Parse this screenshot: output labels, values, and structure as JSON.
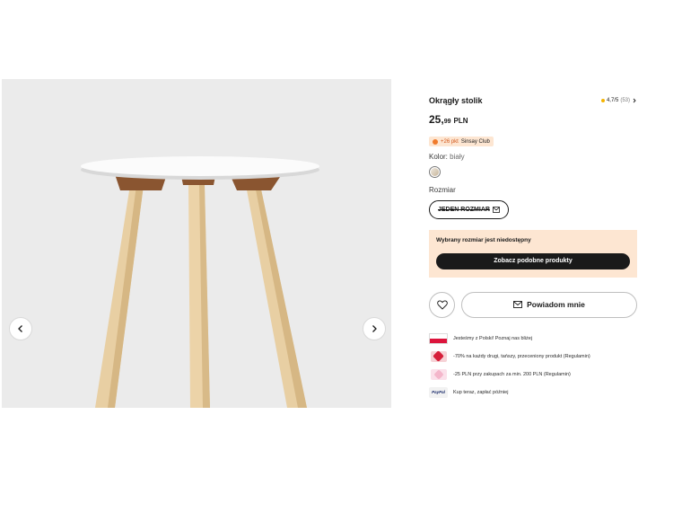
{
  "gallery": {
    "image_alt": "product-photo-round-table",
    "prev_icon": "chevron-left-icon",
    "next_icon": "chevron-right-icon"
  },
  "product": {
    "title": "Okrągły stolik",
    "rating": {
      "value": "4,7/5",
      "count": "(53)"
    },
    "price": {
      "integer": "25,",
      "decimal": "99",
      "currency": "PLN"
    },
    "club_badge": {
      "points": "+26 pkt",
      "club": "Sinsay Club"
    },
    "color": {
      "label": "Kolor:",
      "value": "biały"
    },
    "size": {
      "label": "Rozmiar",
      "option": "JEDEN ROZMIAR"
    },
    "unavailable": {
      "message": "Wybrany rozmiar jest niedostępny",
      "button": "Zobacz podobne produkty"
    },
    "notify_button": "Powiadom mnie",
    "features": [
      {
        "icon": "poland-flag-icon",
        "text": "Jesteśmy z Polski! Poznaj nas bliżej"
      },
      {
        "icon": "discount-tag-icon",
        "text": "-70% na każdy drugi, tańszy, przeceniony produkt (Regulamin)"
      },
      {
        "icon": "voucher-tag-icon",
        "text": "-25 PLN przy zakupach za min. 200 PLN (Regulamin)"
      },
      {
        "icon": "paypal-icon",
        "text": "Kup teraz, zapłać później",
        "badge": "PayPal"
      }
    ]
  },
  "colors": {
    "primary_dark": "#1a1a1a",
    "notice_bg": "#fde6d2",
    "club_orange": "#d2561a",
    "star": "#f5b400"
  }
}
